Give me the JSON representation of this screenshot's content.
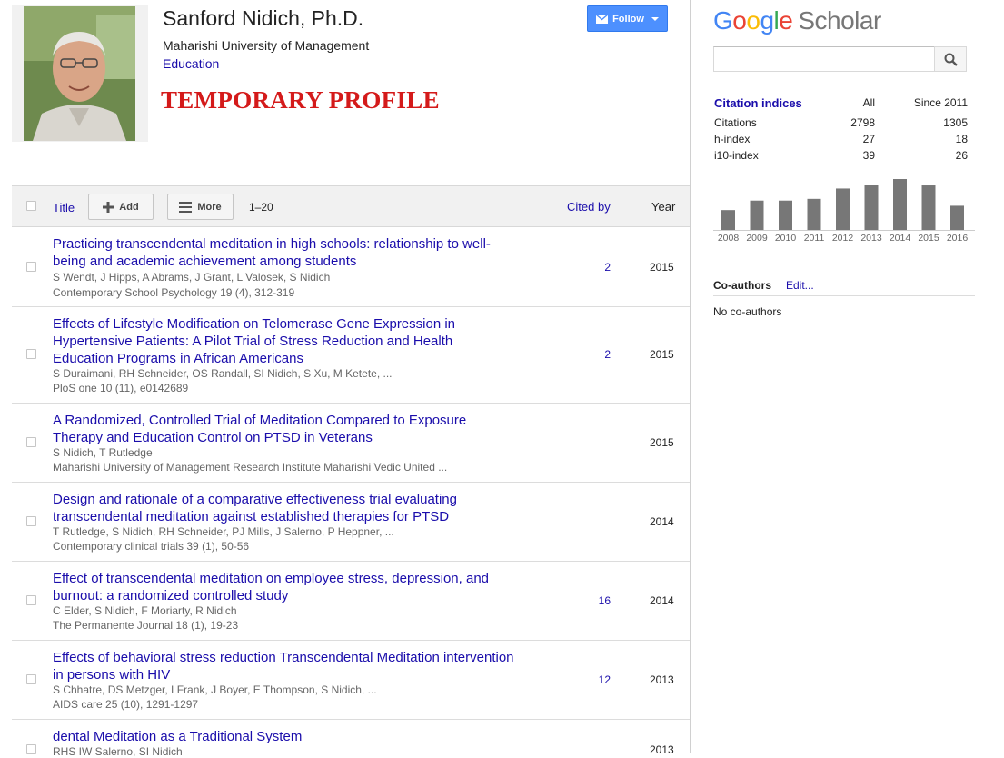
{
  "profile": {
    "name": "Sanford Nidich, Ph.D.",
    "affiliation": "Maharishi University of Management",
    "field": "Education",
    "temporary_banner": "TEMPORARY PROFILE",
    "follow_label": "Follow"
  },
  "table": {
    "col_title": "Title",
    "add_label": "Add",
    "more_label": "More",
    "range": "1–20",
    "col_cited_by": "Cited by",
    "col_year": "Year"
  },
  "articles": [
    {
      "title": "Practicing transcendental meditation in high schools: relationship to well-being and academic achievement among students",
      "authors": "S Wendt, J Hipps, A Abrams, J Grant, L Valosek, S Nidich",
      "venue": "Contemporary School Psychology 19 (4), 312-319",
      "cited_by": "2",
      "year": "2015"
    },
    {
      "title": "Effects of Lifestyle Modification on Telomerase Gene Expression in Hypertensive Patients: A Pilot Trial of Stress Reduction and Health Education Programs in African Americans",
      "authors": "S Duraimani, RH Schneider, OS Randall, SI Nidich, S Xu, M Ketete, ...",
      "venue": "PloS one 10 (11), e0142689",
      "cited_by": "2",
      "year": "2015"
    },
    {
      "title": "A Randomized, Controlled Trial of Meditation Compared to Exposure Therapy and Education Control on PTSD in Veterans",
      "authors": "S Nidich, T Rutledge",
      "venue": "Maharishi University of Management Research Institute Maharishi Vedic United ...",
      "cited_by": "",
      "year": "2015"
    },
    {
      "title": "Design and rationale of a comparative effectiveness trial evaluating transcendental meditation against established therapies for PTSD",
      "authors": "T Rutledge, S Nidich, RH Schneider, PJ Mills, J Salerno, P Heppner, ...",
      "venue": "Contemporary clinical trials 39 (1), 50-56",
      "cited_by": "",
      "year": "2014"
    },
    {
      "title": "Effect of transcendental meditation on employee stress, depression, and burnout: a randomized controlled study",
      "authors": "C Elder, S Nidich, F Moriarty, R Nidich",
      "venue": "The Permanente Journal 18 (1), 19-23",
      "cited_by": "16",
      "year": "2014"
    },
    {
      "title": "Effects of behavioral stress reduction Transcendental Meditation intervention in persons with HIV",
      "authors": "S Chhatre, DS Metzger, I Frank, J Boyer, E Thompson, S Nidich, ...",
      "venue": "AIDS care 25 (10), 1291-1297",
      "cited_by": "12",
      "year": "2013"
    },
    {
      "title": "dental Meditation as a Traditional System",
      "authors": "RHS IW Salerno, SI Nidich",
      "venue": "",
      "cited_by": "",
      "year": "2013"
    }
  ],
  "sidebar": {
    "logo_google": "Google",
    "logo_scholar": "Scholar",
    "search_placeholder": "",
    "citation_indices": {
      "title": "Citation indices",
      "col_all": "All",
      "col_since": "Since 2011",
      "rows": [
        {
          "label": "Citations",
          "all": "2798",
          "since": "1305"
        },
        {
          "label": "h-index",
          "all": "27",
          "since": "18"
        },
        {
          "label": "i10-index",
          "all": "39",
          "since": "26"
        }
      ]
    },
    "coauthors_title": "Co-authors",
    "coauthors_edit": "Edit...",
    "coauthors_none": "No co-authors"
  },
  "chart_data": {
    "type": "bar",
    "categories": [
      "2008",
      "2009",
      "2010",
      "2011",
      "2012",
      "2013",
      "2014",
      "2015",
      "2016"
    ],
    "values": [
      115,
      170,
      170,
      180,
      240,
      260,
      295,
      258,
      140
    ],
    "bar_color": "#777777"
  },
  "colors": {
    "link": "#1a0dab",
    "follow_button": "#4d90fe",
    "banner": "#d41a1a",
    "google_blue": "#4285f4",
    "google_red": "#ea4335",
    "google_yellow": "#fbbc05",
    "google_green": "#34a853"
  }
}
